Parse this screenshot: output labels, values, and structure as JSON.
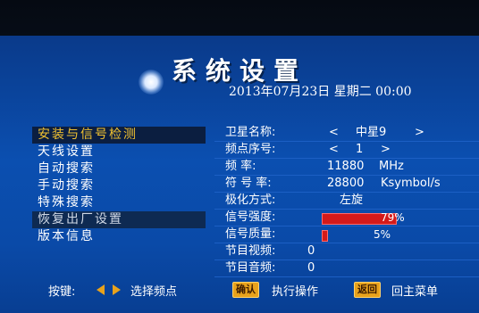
{
  "screen": {
    "title": "系统设置",
    "datetime": "2013年07月23日  星期二  00:00"
  },
  "menu": {
    "items": [
      {
        "label": "安装与信号检测",
        "state": "selected"
      },
      {
        "label": "天线设置",
        "state": "normal"
      },
      {
        "label": "自动搜索",
        "state": "normal"
      },
      {
        "label": "手动搜索",
        "state": "normal"
      },
      {
        "label": "特殊搜索",
        "state": "normal"
      },
      {
        "label": "恢复出厂设置",
        "state": "dim"
      },
      {
        "label": "版本信息",
        "state": "normal"
      }
    ]
  },
  "settings": {
    "satellite_name_label": "卫星名称:",
    "satellite_name_value": "中星9",
    "freq_index_label": "频点序号:",
    "freq_index_value": "1",
    "frequency_label": "频    率:",
    "frequency_value": "11880",
    "frequency_unit": "MHz",
    "symbol_rate_label": "符 号 率:",
    "symbol_rate_value": "28800",
    "symbol_rate_unit": "Ksymbol/s",
    "polarization_label": "极化方式:",
    "polarization_value": "左旋",
    "signal_strength_label": "信号强度:",
    "signal_strength_text": "79%",
    "signal_strength_percent": 79,
    "signal_quality_label": "信号质量:",
    "signal_quality_text": "5%",
    "signal_quality_percent": 5,
    "video_programs_label": "节目视频:",
    "video_programs_value": "0",
    "audio_programs_label": "节目音频:",
    "audio_programs_value": "0"
  },
  "footer": {
    "keys_label": "按键:",
    "select_freq_label": "选择频点",
    "confirm_key": "确认",
    "confirm_action": "执行操作",
    "back_key": "返回",
    "back_action": "回主菜单"
  },
  "colors": {
    "screen_blue": "#0b4fb0",
    "selected_text": "#f2c230",
    "bar_red": "#d41a1a",
    "key_orange": "#e8a21c"
  }
}
